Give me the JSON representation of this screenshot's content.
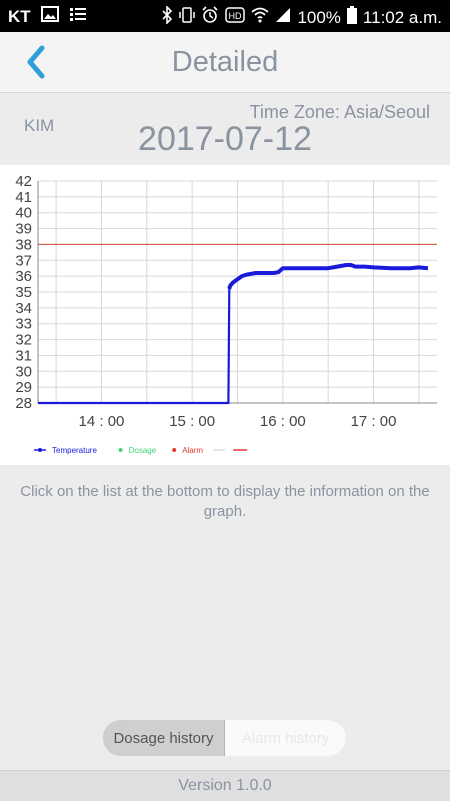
{
  "status_bar": {
    "carrier": "KT",
    "battery": "100%",
    "time": "11:02 a.m.",
    "icons_left": [
      "image-icon",
      "list-icon"
    ],
    "icons_right": [
      "bluetooth-icon",
      "vibrate-icon",
      "alarm-icon",
      "hd-icon",
      "wifi-icon",
      "signal-icon",
      "battery-icon"
    ]
  },
  "header": {
    "title": "Detailed",
    "back_icon": "chevron-left-icon"
  },
  "info": {
    "user": "KIM",
    "time_zone": "Time Zone: Asia/Seoul",
    "date": "2017-07-12"
  },
  "chart_data": {
    "type": "line",
    "x_tick_labels": [
      "14 : 00",
      "15 : 00",
      "16 : 00",
      "17 : 00"
    ],
    "x_ticks_hours": [
      14,
      15,
      16,
      17
    ],
    "xlim_hours": [
      13.3,
      17.7
    ],
    "ylim": [
      28,
      42
    ],
    "y_ticks": [
      42,
      41,
      40,
      39,
      38,
      37,
      36,
      35,
      34,
      33,
      32,
      31,
      30,
      29,
      28
    ],
    "grid": true,
    "legend": [
      {
        "name": "Temperature",
        "color": "#1a1adb"
      },
      {
        "name": "Dosage",
        "color": "#3ed37a"
      },
      {
        "name": "Alarm",
        "color": "#e0392b"
      }
    ],
    "alarm_threshold": 38,
    "series": [
      {
        "name": "Temperature",
        "color": "#1a1adb",
        "x_hours": [
          13.3,
          15.4,
          15.41,
          15.42,
          15.45,
          15.5,
          15.55,
          15.6,
          15.7,
          15.8,
          15.9,
          15.95,
          16.0,
          16.1,
          16.3,
          16.5,
          16.6,
          16.7,
          16.75,
          16.8,
          16.9,
          17.0,
          17.2,
          17.4,
          17.5,
          17.6
        ],
        "values": [
          28.0,
          28.0,
          35.2,
          35.4,
          35.6,
          35.8,
          36.0,
          36.1,
          36.2,
          36.2,
          36.2,
          36.25,
          36.5,
          36.5,
          36.5,
          36.5,
          36.6,
          36.7,
          36.7,
          36.6,
          36.6,
          36.55,
          36.5,
          36.5,
          36.55,
          36.5
        ]
      }
    ],
    "dosage_points": [],
    "alarm_points": []
  },
  "hint": "Click on the list at the bottom to display the information on the graph.",
  "toggle": {
    "active": "Dosage history",
    "inactive": "Alarm history"
  },
  "footer": {
    "version": "Version 1.0.0"
  }
}
